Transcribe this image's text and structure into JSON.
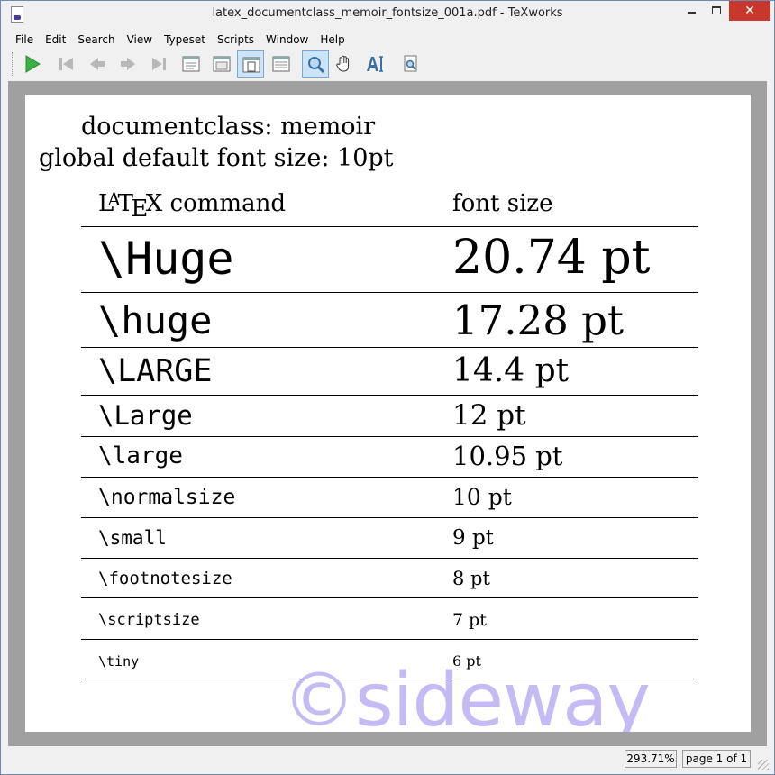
{
  "window": {
    "title": "latex_documentclass_memoir_fontsize_001a.pdf - TeXworks",
    "close_glyph": "✕"
  },
  "menu": [
    "File",
    "Edit",
    "Search",
    "View",
    "Typeset",
    "Scripts",
    "Window",
    "Help"
  ],
  "toolbar": {
    "icons": [
      "typeset-play-icon",
      "first-page-icon",
      "previous-page-icon",
      "next-page-icon",
      "last-page-icon",
      "actual-size-icon",
      "fit-width-icon",
      "fit-page-icon",
      "fit-window-icon",
      "magnify-icon",
      "scroll-hand-icon",
      "select-text-icon",
      "find-icon"
    ],
    "accent_green": "#3cb043",
    "active_bg": "#cce4f7"
  },
  "document": {
    "line1": "documentclass: memoir",
    "line2": "global default font size: 10pt",
    "table": {
      "header_latex_L": "L",
      "header_latex_A": "A",
      "header_latex_T": "T",
      "header_latex_E": "E",
      "header_latex_X": "X",
      "header_cmd_suffix": " command",
      "header_size": "font size",
      "rows": [
        {
          "command": "\\Huge",
          "size": "20.74 pt"
        },
        {
          "command": "\\huge",
          "size": "17.28 pt"
        },
        {
          "command": "\\LARGE",
          "size": "14.4 pt"
        },
        {
          "command": "\\Large",
          "size": "12 pt"
        },
        {
          "command": "\\large",
          "size": "10.95 pt"
        },
        {
          "command": "\\normalsize",
          "size": "10 pt"
        },
        {
          "command": "\\small",
          "size": "9 pt"
        },
        {
          "command": "\\footnotesize",
          "size": "8 pt"
        },
        {
          "command": "\\scriptsize",
          "size": "7 pt"
        },
        {
          "command": "\\tiny",
          "size": "6 pt"
        }
      ]
    },
    "watermark": "©sideway"
  },
  "status": {
    "zoom": "293.71%",
    "page": "page 1 of 1"
  }
}
